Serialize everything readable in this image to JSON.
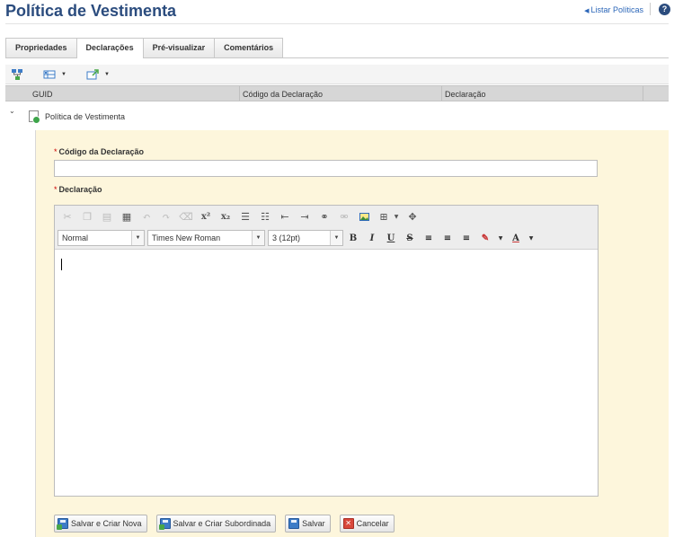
{
  "page": {
    "title": "Política de Vestimenta",
    "list_link": "Listar Políticas",
    "help_icon": "question-circle-icon"
  },
  "tabs": [
    {
      "label": "Propriedades",
      "active": false
    },
    {
      "label": "Declarações",
      "active": true
    },
    {
      "label": "Pré-visualizar",
      "active": false
    },
    {
      "label": "Comentários",
      "active": false
    }
  ],
  "toolbar": {
    "icons": [
      "hierarchy-icon",
      "view-mode-icon",
      "export-icon"
    ]
  },
  "grid": {
    "columns": [
      "GUID",
      "Código da Declaração",
      "Declaração"
    ]
  },
  "tree": {
    "item_label": "Política de Vestimenta"
  },
  "form": {
    "code_label": "Código da Declaração",
    "code_value": "",
    "declaration_label": "Declaração",
    "required_mark": "*"
  },
  "editor": {
    "style_select": "Normal",
    "font_select": "Times New Roman",
    "size_select": "3 (12pt)",
    "format_buttons": [
      "B",
      "I",
      "U",
      "S"
    ]
  },
  "actions": {
    "save_new": "Salvar e Criar Nova",
    "save_child": "Salvar e Criar Subordinada",
    "save": "Salvar",
    "cancel": "Cancelar"
  },
  "colors": {
    "title": "#2b4c7e",
    "link": "#2b66b8",
    "panel_bg": "#fdf6dc",
    "grid_header": "#d6d6d6"
  }
}
